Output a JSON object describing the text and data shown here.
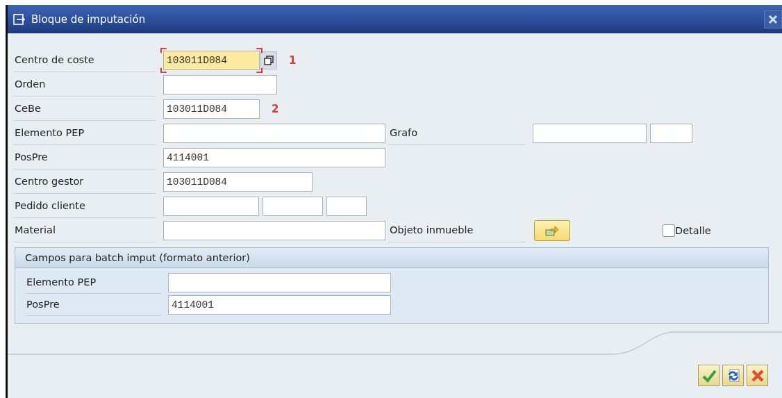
{
  "window": {
    "title": "Bloque de imputación"
  },
  "rows": [
    {
      "label": "Centro de coste",
      "inputs": [
        {
          "value": "103011D084",
          "focused": true
        }
      ],
      "help_button": true,
      "annotation": "1"
    },
    {
      "label": "Orden",
      "inputs": [
        {
          "focused": false
        }
      ]
    },
    {
      "label": "CeBe",
      "inputs": [
        {
          "value": "103011D084",
          "focused": false
        }
      ],
      "annotation": "2"
    },
    {
      "label": "Elemento PEP",
      "inputs": [
        {
          "focused": false
        }
      ],
      "right": {
        "kind": "fields",
        "label": "Grafo",
        "inputs": [
          {
            "focused": false
          },
          {
            "focused": false
          }
        ]
      }
    },
    {
      "label": "PosPre",
      "inputs": [
        {
          "value": "4114001",
          "focused": false
        }
      ]
    },
    {
      "label": "Centro gestor",
      "inputs": [
        {
          "value": "103011D084",
          "focused": false
        }
      ]
    },
    {
      "label": "Pedido cliente",
      "inputs": [
        {
          "focused": false
        },
        {
          "focused": false
        },
        {
          "focused": false
        }
      ]
    },
    {
      "label": "Material",
      "inputs": [
        {
          "focused": false
        }
      ],
      "right": {
        "kind": "button",
        "label": "Objeto inmueble"
      },
      "checkbox": {
        "label": "Detalle",
        "checked": false
      }
    }
  ],
  "group": {
    "title": "Campos para batch imput (formato anterior)",
    "rows": [
      {
        "label": "Elemento PEP"
      },
      {
        "label": "PosPre",
        "value": "4114001"
      }
    ]
  },
  "footer_buttons": [
    {
      "kind": "confirm"
    },
    {
      "kind": "refresh"
    },
    {
      "kind": "cancel"
    }
  ]
}
